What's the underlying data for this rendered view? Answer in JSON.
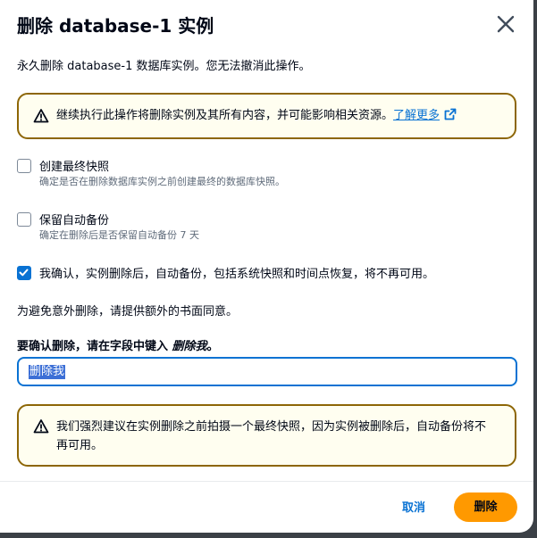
{
  "dialog": {
    "title": "删除 database-1 实例",
    "description": "永久删除 database-1 数据库实例。您无法撤消此操作。"
  },
  "warning_alert": {
    "text": "继续执行此操作将删除实例及其所有内容，并可能影响相关资源。",
    "link_label": "了解更多"
  },
  "options": [
    {
      "label": "创建最终快照",
      "description": "确定是否在删除数据库实例之前创建最终的数据库快照。",
      "checked": false
    },
    {
      "label": "保留自动备份",
      "description": "确定在删除后是否保留自动备份 7 天",
      "checked": false
    },
    {
      "label": "我确认，实例删除后，自动备份，包括系统快照和时间点恢复，将不再可用。",
      "checked": true
    }
  ],
  "hint": "为避免意外删除，请提供额外的书面同意。",
  "confirm": {
    "label_prefix": "要确认删除，请在字段中键入 ",
    "label_keyword": "删除我",
    "label_suffix": "。",
    "value": "删除我"
  },
  "snapshot_alert": {
    "text": "我们强烈建议在实例删除之前拍摄一个最终快照，因为实例被删除后，自动备份将不再可用。"
  },
  "footer": {
    "cancel_label": "取消",
    "delete_label": "删除"
  },
  "colors": {
    "primary_button": "#ff9900",
    "link": "#0972d3",
    "warning_border": "#8d6605",
    "warning_bg": "#fffef0"
  }
}
